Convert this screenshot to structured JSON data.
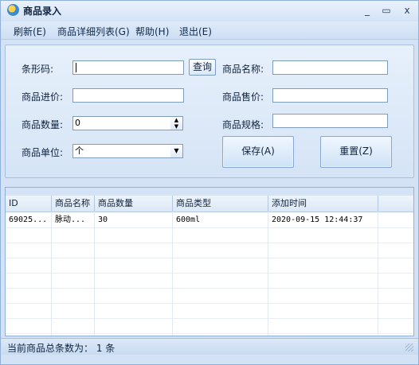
{
  "window": {
    "title": "商品录入",
    "controls": {
      "minimize": "_",
      "maximize": "▭",
      "close": "x"
    }
  },
  "menu": [
    {
      "label": "刷新(E)"
    },
    {
      "label": "商品详细列表(G)"
    },
    {
      "label": "帮助(H)"
    },
    {
      "label": "退出(E)"
    }
  ],
  "form": {
    "barcode_label": "条形码:",
    "barcode_value": "",
    "query_button": "查询",
    "name_label": "商品名称:",
    "name_value": "",
    "cost_label": "商品进价:",
    "cost_value": "",
    "price_label": "商品售价:",
    "price_value": "",
    "quantity_label": "商品数量:",
    "quantity_value": "0",
    "spec_label": "商品规格:",
    "spec_value": "",
    "unit_label": "商品单位:",
    "unit_value": "个",
    "save_button": "保存(A)",
    "reset_button": "重置(Z)"
  },
  "grid": {
    "columns": [
      "ID",
      "商品名称",
      "商品数量",
      "商品类型",
      "添加时间"
    ],
    "rows": [
      [
        "69025...",
        "脉动...",
        "30",
        "600ml",
        "2020-09-15 12:44:37"
      ]
    ]
  },
  "status": {
    "text": "当前商品总条数为： 1 条"
  }
}
